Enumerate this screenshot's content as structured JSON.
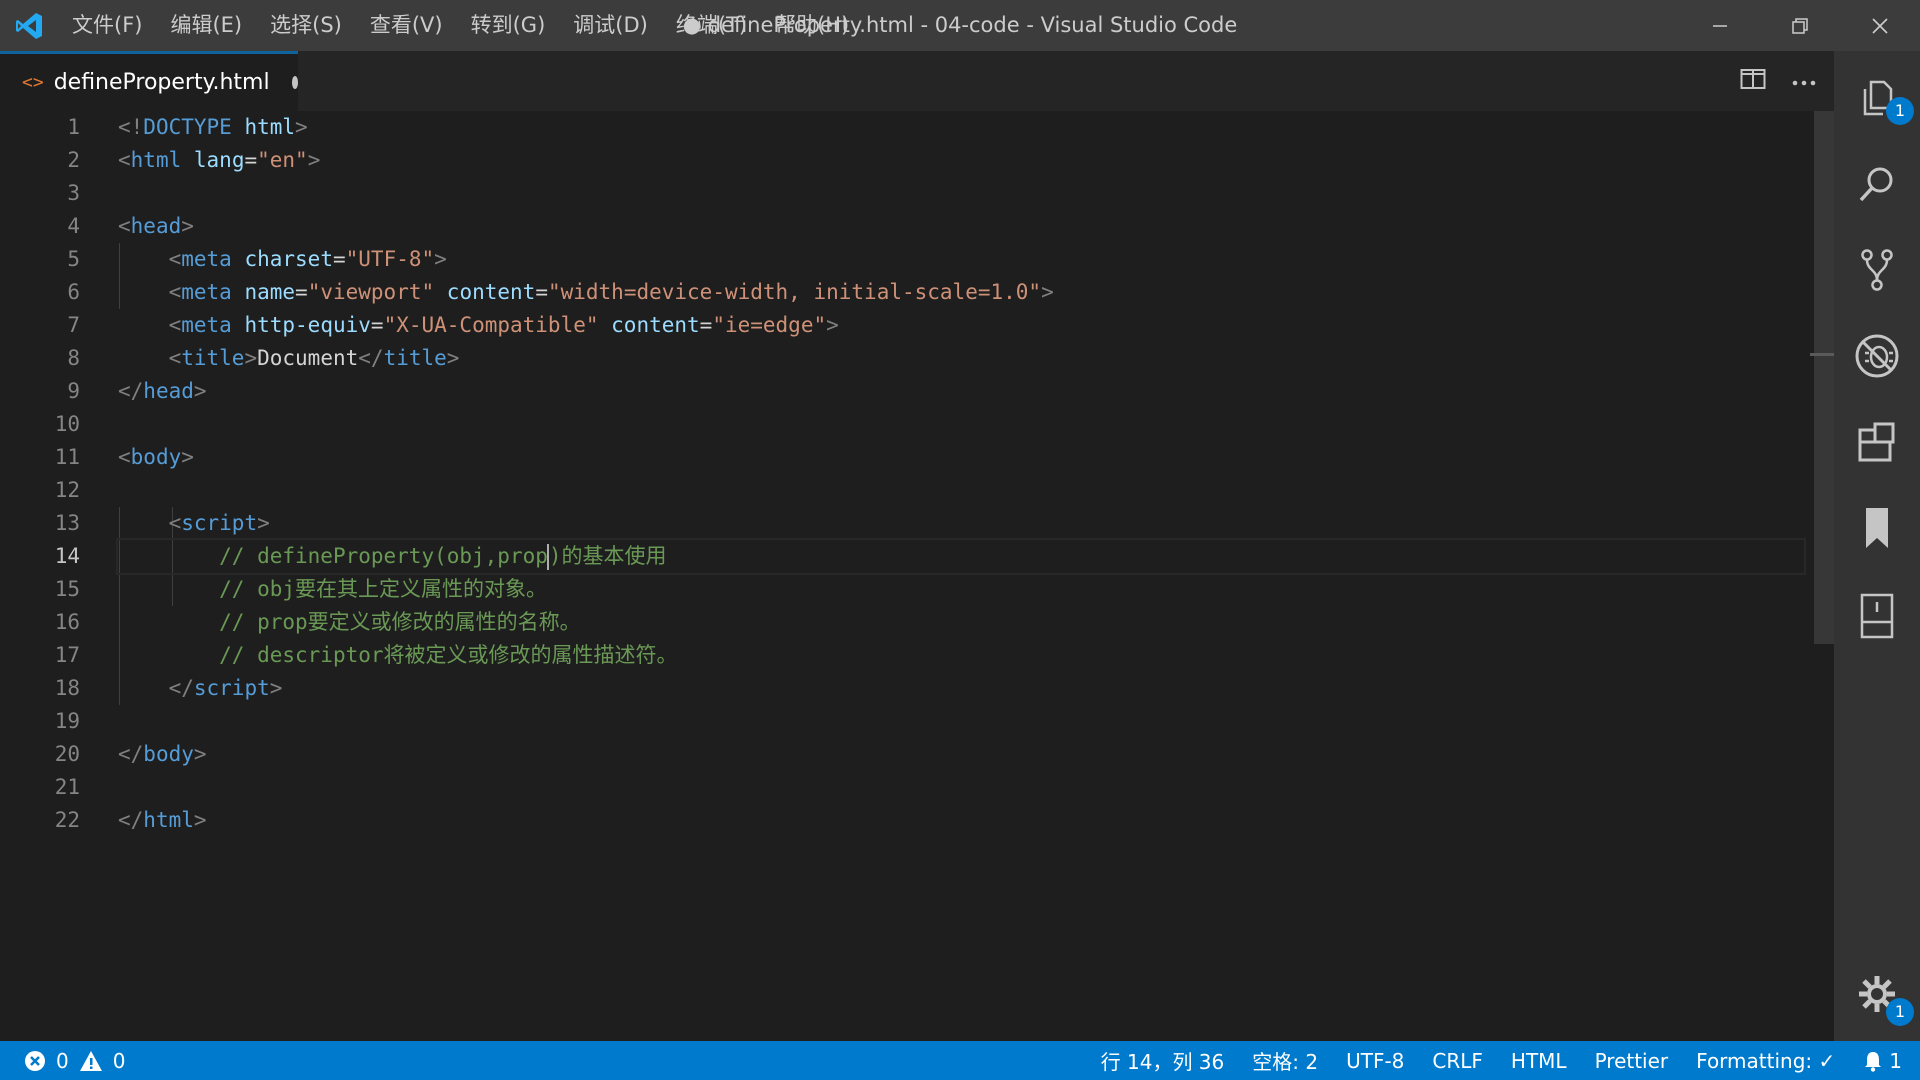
{
  "titlebar": {
    "menu": [
      "文件(F)",
      "编辑(E)",
      "选择(S)",
      "查看(V)",
      "转到(G)",
      "调试(D)",
      "终端(T)",
      "帮助(H)"
    ],
    "window_title": "● defineProperty.html - 04-code - Visual Studio Code"
  },
  "tab": {
    "icon_text": "<>",
    "label": "defineProperty.html"
  },
  "editor": {
    "line_numbers": [
      "1",
      "2",
      "3",
      "4",
      "5",
      "6",
      "7",
      "8",
      "9",
      "10",
      "11",
      "12",
      "13",
      "14",
      "15",
      "16",
      "17",
      "18",
      "19",
      "20",
      "21",
      "22"
    ],
    "current_line": 14
  },
  "activity": {
    "explorer_badge": "1",
    "settings_badge": "1"
  },
  "status": {
    "errors": "0",
    "warnings": "0",
    "position": "行 14，列 36",
    "spaces": "空格: 2",
    "encoding": "UTF-8",
    "eol": "CRLF",
    "language": "HTML",
    "prettier": "Prettier",
    "formatting": "Formatting: ✓",
    "notifications": "1"
  },
  "colors": {
    "accent": "#007acc",
    "tag": "#569cd6",
    "attribute": "#9cdcfe",
    "string": "#ce9178",
    "comment": "#6a9955"
  }
}
